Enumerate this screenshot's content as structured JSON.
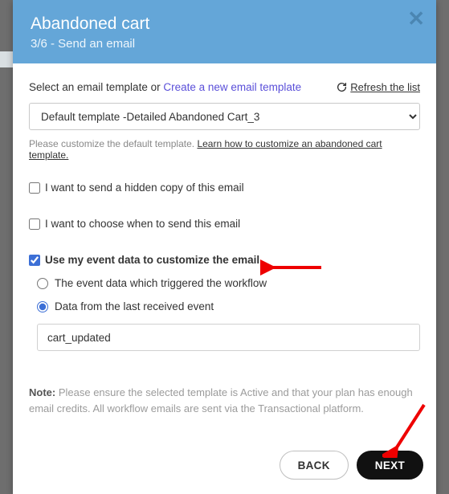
{
  "header": {
    "title": "Abandoned cart",
    "subtitle": "3/6 - Send an email"
  },
  "top": {
    "select_label_prefix": "Select an email template or ",
    "create_link": "Create a new email template",
    "refresh_label": " Refresh the list"
  },
  "template": {
    "selected": "Default template -Detailed Abandoned Cart_3"
  },
  "hint": {
    "prefix": "Please customize the default template. ",
    "link": "Learn how to customize an abandoned cart template."
  },
  "checkboxes": {
    "hidden_copy_label": "I want to send a hidden copy of this email",
    "choose_when_label": "I want to choose when to send this email",
    "use_event_data_label": "Use my event data to customize the email"
  },
  "radios": {
    "triggered_label": "The event data which triggered the workflow",
    "last_received_label": "Data from the last received event"
  },
  "event_input_value": "cart_updated",
  "note": {
    "label": "Note:",
    "text": " Please ensure the selected template is Active and that your plan has enough email credits. All workflow emails are sent via the Transactional platform."
  },
  "footer": {
    "back": "BACK",
    "next": "NEXT"
  }
}
